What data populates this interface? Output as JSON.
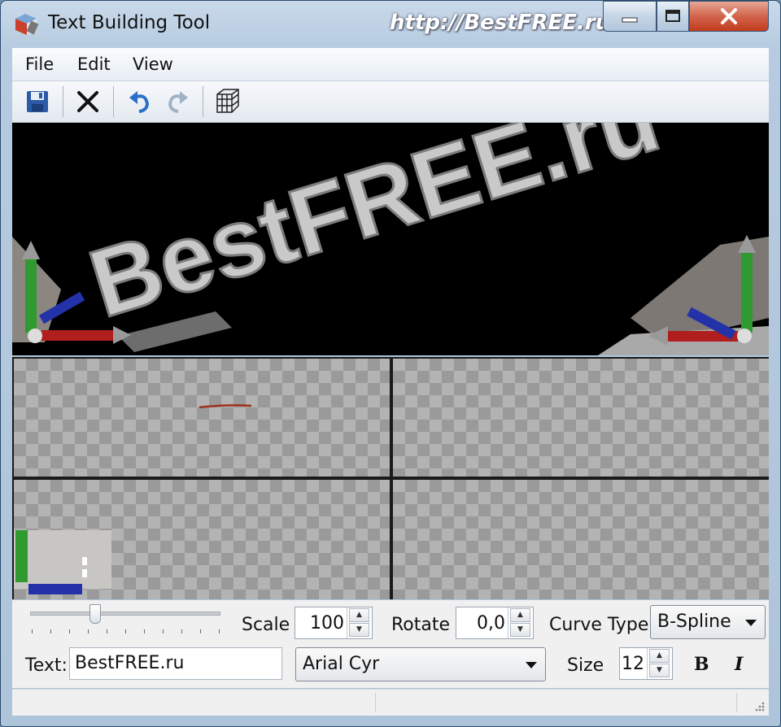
{
  "window": {
    "title": "Text Building Tool",
    "watermark": "http://BestFREE.ru"
  },
  "menu": {
    "items": [
      "File",
      "Edit",
      "View"
    ]
  },
  "toolbar": {
    "icons": [
      "save-icon",
      "delete-icon",
      "undo-icon",
      "redo-icon",
      "grid-icon"
    ]
  },
  "viewport": {
    "scene_text": "BestFREE.ru"
  },
  "controls": {
    "scale_label": "Scale",
    "scale_value": "100",
    "rotate_label": "Rotate",
    "rotate_value": "0,0",
    "curve_type_label": "Curve Type",
    "curve_type_value": "B-Spline",
    "text_label": "Text:",
    "text_value": "BestFREE.ru",
    "font_value": "Arial Cyr",
    "size_label": "Size",
    "size_value": "12",
    "bold_label": "B",
    "italic_label": "I",
    "slider_level": 0.34
  },
  "colors": {
    "axis_x": "#b01e1e",
    "axis_y": "#2f9a2f",
    "axis_z": "#2332a8",
    "close_button": "#c9472b"
  }
}
